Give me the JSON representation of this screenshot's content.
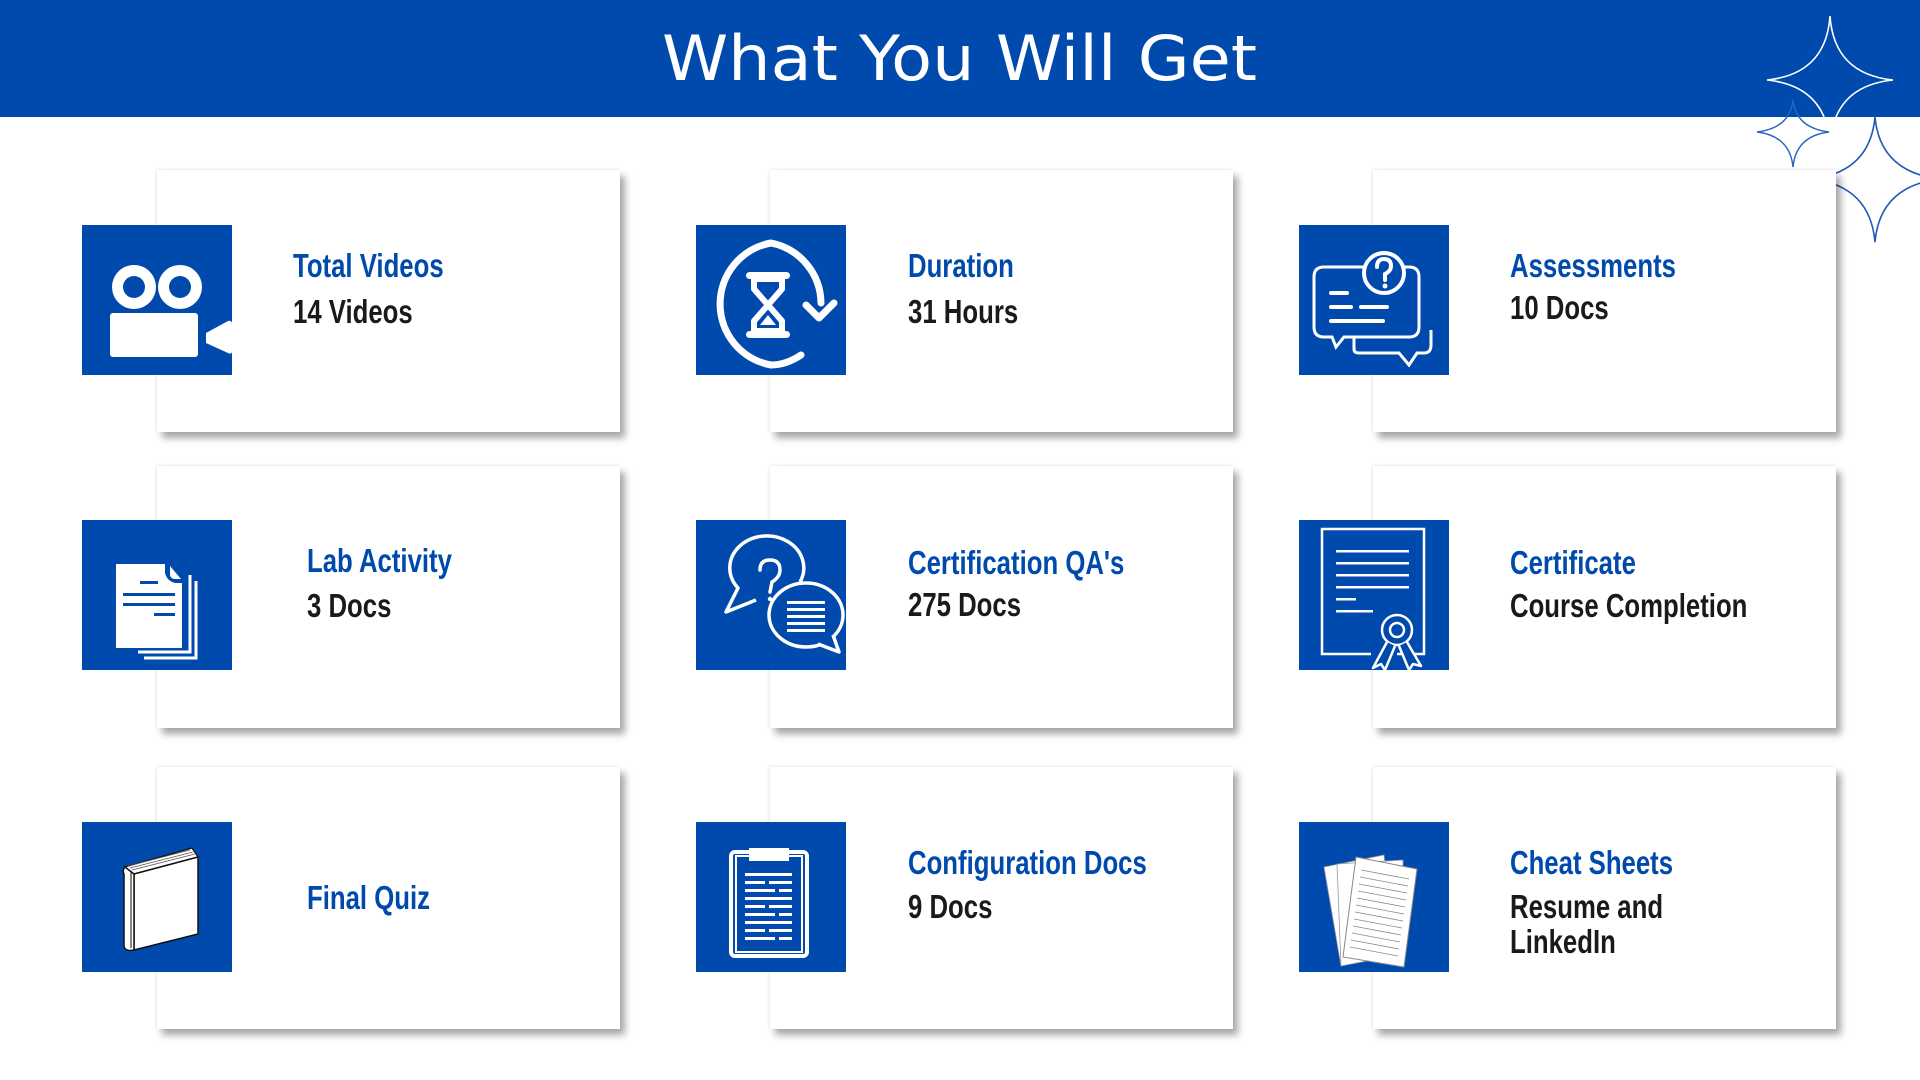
{
  "header": {
    "title": "What You Will Get",
    "background_color": "#004aad"
  },
  "accent_color": "#004aad",
  "cards": [
    {
      "label": "Total Videos",
      "value": "14 Videos",
      "icon": "video-camera-icon"
    },
    {
      "label": "Duration",
      "value": "31 Hours",
      "icon": "hourglass-refresh-icon"
    },
    {
      "label": "Assessments",
      "value": "10 Docs",
      "icon": "question-chat-icon"
    },
    {
      "label": "Lab Activity",
      "value": "3 Docs",
      "icon": "documents-icon"
    },
    {
      "label": "Certification QA's",
      "value": "275 Docs",
      "icon": "qa-speech-bubbles-icon"
    },
    {
      "label": "Certificate",
      "value": "Course Completion",
      "icon": "certificate-ribbon-icon"
    },
    {
      "label": "Final Quiz",
      "value": "",
      "icon": "book-icon"
    },
    {
      "label": "Configuration Docs",
      "value": "9 Docs",
      "icon": "clipboard-icon"
    },
    {
      "label": "Cheat Sheets",
      "value_lines": [
        "Resume and",
        "LinkedIn"
      ],
      "icon": "papers-icon"
    }
  ],
  "decorations": [
    "sparkle-star-icon",
    "sparkle-star-icon",
    "sparkle-star-icon"
  ]
}
